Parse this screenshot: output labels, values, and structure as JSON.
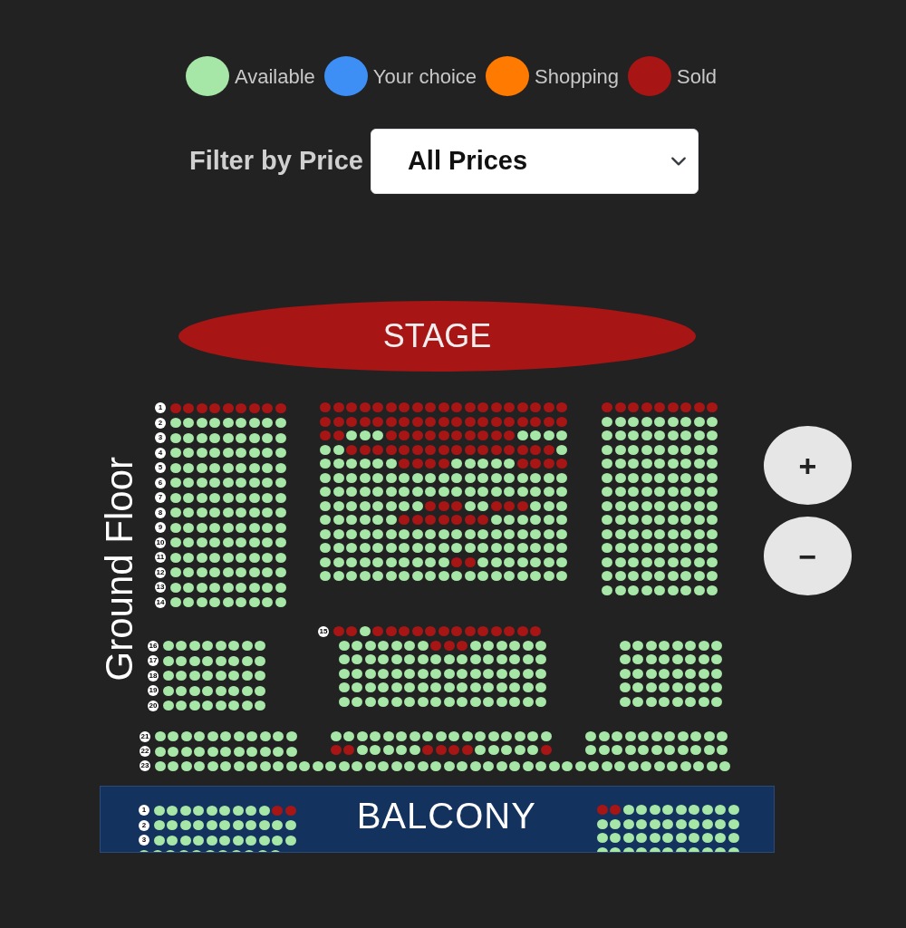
{
  "legend": [
    {
      "label": "Available",
      "color": "#a6e6a6"
    },
    {
      "label": "Your choice",
      "color": "#3d8ef5"
    },
    {
      "label": "Shopping",
      "color": "#ff7a00"
    },
    {
      "label": "Sold",
      "color": "#a81515"
    }
  ],
  "filter": {
    "label": "Filter by Price",
    "value": "All Prices"
  },
  "stage": "STAGE",
  "zoom_buttons": [
    "+",
    "−"
  ],
  "ground_floor": {
    "title": "Ground Floor",
    "tiers": [
      {
        "blocks": [
          {
            "rows": [
              {
                "label": "1",
                "sold": [
                  true,
                  true,
                  true,
                  true,
                  true,
                  true,
                  true,
                  true,
                  true
                ]
              },
              {
                "label": "2",
                "sold": [
                  false,
                  false,
                  false,
                  false,
                  false,
                  false,
                  false,
                  false,
                  false
                ]
              },
              {
                "label": "3",
                "sold": [
                  false,
                  false,
                  false,
                  false,
                  false,
                  false,
                  false,
                  false,
                  false
                ]
              },
              {
                "label": "4",
                "sold": [
                  false,
                  false,
                  false,
                  false,
                  false,
                  false,
                  false,
                  false,
                  false
                ]
              },
              {
                "label": "5",
                "sold": [
                  false,
                  false,
                  false,
                  false,
                  false,
                  false,
                  false,
                  false,
                  false
                ]
              },
              {
                "label": "6",
                "sold": [
                  false,
                  false,
                  false,
                  false,
                  false,
                  false,
                  false,
                  false,
                  false
                ]
              },
              {
                "label": "7",
                "sold": [
                  false,
                  false,
                  false,
                  false,
                  false,
                  false,
                  false,
                  false,
                  false
                ]
              },
              {
                "label": "8",
                "sold": [
                  false,
                  false,
                  false,
                  false,
                  false,
                  false,
                  false,
                  false,
                  false
                ]
              },
              {
                "label": "9",
                "sold": [
                  false,
                  false,
                  false,
                  false,
                  false,
                  false,
                  false,
                  false,
                  false
                ]
              },
              {
                "label": "10",
                "sold": [
                  false,
                  false,
                  false,
                  false,
                  false,
                  false,
                  false,
                  false,
                  false
                ]
              },
              {
                "label": "11",
                "sold": [
                  false,
                  false,
                  false,
                  false,
                  false,
                  false,
                  false,
                  false,
                  false
                ]
              },
              {
                "label": "12",
                "sold": [
                  false,
                  false,
                  false,
                  false,
                  false,
                  false,
                  false,
                  false,
                  false
                ]
              },
              {
                "label": "13",
                "sold": [
                  false,
                  false,
                  false,
                  false,
                  false,
                  false,
                  false,
                  false,
                  false
                ]
              },
              {
                "label": "14",
                "sold": [
                  false,
                  false,
                  false,
                  false,
                  false,
                  false,
                  false,
                  false,
                  false
                ]
              }
            ]
          },
          {
            "rows": [
              {
                "sold": [
                  true,
                  true,
                  true,
                  true,
                  true,
                  true,
                  true,
                  true,
                  true,
                  true,
                  true,
                  true,
                  true,
                  true,
                  true,
                  true,
                  true,
                  true,
                  true
                ]
              },
              {
                "sold": [
                  true,
                  true,
                  true,
                  true,
                  true,
                  true,
                  true,
                  true,
                  true,
                  true,
                  true,
                  true,
                  true,
                  true,
                  true,
                  true,
                  true,
                  true,
                  true
                ]
              },
              {
                "sold": [
                  true,
                  true,
                  false,
                  false,
                  false,
                  true,
                  true,
                  true,
                  true,
                  true,
                  true,
                  true,
                  true,
                  true,
                  true,
                  false,
                  false,
                  false,
                  false
                ]
              },
              {
                "sold": [
                  false,
                  false,
                  true,
                  true,
                  true,
                  true,
                  true,
                  true,
                  true,
                  true,
                  true,
                  true,
                  true,
                  true,
                  true,
                  true,
                  true,
                  true,
                  false
                ]
              },
              {
                "sold": [
                  false,
                  false,
                  false,
                  false,
                  false,
                  false,
                  true,
                  true,
                  true,
                  true,
                  false,
                  false,
                  false,
                  false,
                  false,
                  true,
                  true,
                  true,
                  true
                ]
              },
              {
                "sold": [
                  false,
                  false,
                  false,
                  false,
                  false,
                  false,
                  false,
                  false,
                  false,
                  false,
                  false,
                  false,
                  false,
                  false,
                  false,
                  false,
                  false,
                  false,
                  false
                ]
              },
              {
                "sold": [
                  false,
                  false,
                  false,
                  false,
                  false,
                  false,
                  false,
                  false,
                  false,
                  false,
                  false,
                  false,
                  false,
                  false,
                  false,
                  false,
                  false,
                  false,
                  false
                ]
              },
              {
                "sold": [
                  false,
                  false,
                  false,
                  false,
                  false,
                  false,
                  false,
                  false,
                  true,
                  true,
                  true,
                  false,
                  false,
                  true,
                  true,
                  true,
                  false,
                  false,
                  false
                ]
              },
              {
                "sold": [
                  false,
                  false,
                  false,
                  false,
                  false,
                  false,
                  true,
                  true,
                  true,
                  true,
                  true,
                  true,
                  true,
                  false,
                  false,
                  false,
                  false,
                  false,
                  false
                ]
              },
              {
                "sold": [
                  false,
                  false,
                  false,
                  false,
                  false,
                  false,
                  false,
                  false,
                  false,
                  false,
                  false,
                  false,
                  false,
                  false,
                  false,
                  false,
                  false,
                  false,
                  false
                ]
              },
              {
                "sold": [
                  false,
                  false,
                  false,
                  false,
                  false,
                  false,
                  false,
                  false,
                  false,
                  false,
                  false,
                  false,
                  false,
                  false,
                  false,
                  false,
                  false,
                  false,
                  false
                ]
              },
              {
                "sold": [
                  false,
                  false,
                  false,
                  false,
                  false,
                  false,
                  false,
                  false,
                  false,
                  false,
                  true,
                  true,
                  false,
                  false,
                  false,
                  false,
                  false,
                  false,
                  false
                ]
              },
              {
                "sold": [
                  false,
                  false,
                  false,
                  false,
                  false,
                  false,
                  false,
                  false,
                  false,
                  false,
                  false,
                  false,
                  false,
                  false,
                  false,
                  false,
                  false,
                  false,
                  false
                ]
              }
            ]
          },
          {
            "rows": [
              {
                "sold": [
                  true,
                  true,
                  true,
                  true,
                  true,
                  true,
                  true,
                  true,
                  true
                ]
              },
              {
                "sold": [
                  false,
                  false,
                  false,
                  false,
                  false,
                  false,
                  false,
                  false,
                  false
                ]
              },
              {
                "sold": [
                  false,
                  false,
                  false,
                  false,
                  false,
                  false,
                  false,
                  false,
                  false
                ]
              },
              {
                "sold": [
                  false,
                  false,
                  false,
                  false,
                  false,
                  false,
                  false,
                  false,
                  false
                ]
              },
              {
                "sold": [
                  false,
                  false,
                  false,
                  false,
                  false,
                  false,
                  false,
                  false,
                  false
                ]
              },
              {
                "sold": [
                  false,
                  false,
                  false,
                  false,
                  false,
                  false,
                  false,
                  false,
                  false
                ]
              },
              {
                "sold": [
                  false,
                  false,
                  false,
                  false,
                  false,
                  false,
                  false,
                  false,
                  false
                ]
              },
              {
                "sold": [
                  false,
                  false,
                  false,
                  false,
                  false,
                  false,
                  false,
                  false,
                  false
                ]
              },
              {
                "sold": [
                  false,
                  false,
                  false,
                  false,
                  false,
                  false,
                  false,
                  false,
                  false
                ]
              },
              {
                "sold": [
                  false,
                  false,
                  false,
                  false,
                  false,
                  false,
                  false,
                  false,
                  false
                ]
              },
              {
                "sold": [
                  false,
                  false,
                  false,
                  false,
                  false,
                  false,
                  false,
                  false,
                  false
                ]
              },
              {
                "sold": [
                  false,
                  false,
                  false,
                  false,
                  false,
                  false,
                  false,
                  false,
                  false
                ]
              },
              {
                "sold": [
                  false,
                  false,
                  false,
                  false,
                  false,
                  false,
                  false,
                  false,
                  false
                ]
              },
              {
                "sold": [
                  false,
                  false,
                  false,
                  false,
                  false,
                  false,
                  false,
                  false,
                  false
                ]
              }
            ]
          }
        ]
      },
      {
        "blocks": [
          {
            "rows": [
              {
                "label": "15",
                "sold": [
                  true,
                  true,
                  false,
                  true,
                  true,
                  true,
                  true,
                  true,
                  true,
                  true,
                  true,
                  true,
                  true,
                  true,
                  true,
                  true
                ]
              }
            ]
          }
        ]
      },
      {
        "blocks": [
          {
            "rows": [
              {
                "label": "16",
                "sold": [
                  false,
                  false,
                  false,
                  false,
                  false,
                  false,
                  false,
                  false
                ]
              },
              {
                "label": "17",
                "sold": [
                  false,
                  false,
                  false,
                  false,
                  false,
                  false,
                  false,
                  false
                ]
              },
              {
                "label": "18",
                "sold": [
                  false,
                  false,
                  false,
                  false,
                  false,
                  false,
                  false,
                  false
                ]
              },
              {
                "label": "19",
                "sold": [
                  false,
                  false,
                  false,
                  false,
                  false,
                  false,
                  false,
                  false
                ]
              },
              {
                "label": "20",
                "sold": [
                  false,
                  false,
                  false,
                  false,
                  false,
                  false,
                  false,
                  false
                ]
              }
            ]
          },
          {
            "rows": [
              {
                "sold": [
                  false,
                  false,
                  false,
                  false,
                  false,
                  false,
                  false,
                  true,
                  true,
                  true,
                  false,
                  false,
                  false,
                  false,
                  false,
                  false
                ]
              },
              {
                "sold": [
                  false,
                  false,
                  false,
                  false,
                  false,
                  false,
                  false,
                  false,
                  false,
                  false,
                  false,
                  false,
                  false,
                  false,
                  false,
                  false
                ]
              },
              {
                "sold": [
                  false,
                  false,
                  false,
                  false,
                  false,
                  false,
                  false,
                  false,
                  false,
                  false,
                  false,
                  false,
                  false,
                  false,
                  false,
                  false
                ]
              },
              {
                "sold": [
                  false,
                  false,
                  false,
                  false,
                  false,
                  false,
                  false,
                  false,
                  false,
                  false,
                  false,
                  false,
                  false,
                  false,
                  false,
                  false
                ]
              },
              {
                "sold": [
                  false,
                  false,
                  false,
                  false,
                  false,
                  false,
                  false,
                  false,
                  false,
                  false,
                  false,
                  false,
                  false,
                  false,
                  false,
                  false
                ]
              }
            ]
          },
          {
            "rows": [
              {
                "sold": [
                  false,
                  false,
                  false,
                  false,
                  false,
                  false,
                  false,
                  false
                ]
              },
              {
                "sold": [
                  false,
                  false,
                  false,
                  false,
                  false,
                  false,
                  false,
                  false
                ]
              },
              {
                "sold": [
                  false,
                  false,
                  false,
                  false,
                  false,
                  false,
                  false,
                  false
                ]
              },
              {
                "sold": [
                  false,
                  false,
                  false,
                  false,
                  false,
                  false,
                  false,
                  false
                ]
              },
              {
                "sold": [
                  false,
                  false,
                  false,
                  false,
                  false,
                  false,
                  false,
                  false
                ]
              }
            ]
          }
        ]
      },
      {
        "blocks": [
          {
            "rows": [
              {
                "label": "21",
                "sold": [
                  false,
                  false,
                  false,
                  false,
                  false,
                  false,
                  false,
                  false,
                  false,
                  false,
                  false
                ]
              },
              {
                "label": "22",
                "sold": [
                  false,
                  false,
                  false,
                  false,
                  false,
                  false,
                  false,
                  false,
                  false,
                  false,
                  false
                ]
              }
            ]
          },
          {
            "rows": [
              {
                "sold": [
                  false,
                  false,
                  false,
                  false,
                  false,
                  false,
                  false,
                  false,
                  false,
                  false,
                  false,
                  false,
                  false,
                  false,
                  false,
                  false,
                  false
                ]
              },
              {
                "sold": [
                  true,
                  true,
                  false,
                  false,
                  false,
                  false,
                  false,
                  true,
                  true,
                  true,
                  true,
                  false,
                  false,
                  false,
                  false,
                  false,
                  true
                ]
              }
            ]
          },
          {
            "rows": [
              {
                "sold": [
                  false,
                  false,
                  false,
                  false,
                  false,
                  false,
                  false,
                  false,
                  false,
                  false,
                  false
                ]
              },
              {
                "sold": [
                  false,
                  false,
                  false,
                  false,
                  false,
                  false,
                  false,
                  false,
                  false,
                  false,
                  false
                ]
              }
            ]
          }
        ]
      },
      {
        "blocks": [
          {
            "rows": [
              {
                "label": "23",
                "sold": [
                  false,
                  false,
                  false,
                  false,
                  false,
                  false,
                  false,
                  false,
                  false,
                  false,
                  false,
                  false,
                  false,
                  false,
                  false,
                  false,
                  false,
                  false,
                  false,
                  false,
                  false,
                  false,
                  false,
                  false,
                  false,
                  false,
                  false,
                  false,
                  false,
                  false,
                  false,
                  false,
                  false,
                  false,
                  false,
                  false,
                  false,
                  false,
                  false,
                  false,
                  false,
                  false,
                  false,
                  false
                ]
              }
            ]
          }
        ]
      }
    ]
  },
  "balcony": {
    "title": "BALCONY",
    "blocks": [
      {
        "rows": [
          {
            "label": "1",
            "sold": [
              false,
              false,
              false,
              false,
              false,
              false,
              false,
              false,
              false,
              true,
              true
            ]
          },
          {
            "label": "2",
            "sold": [
              false,
              false,
              false,
              false,
              false,
              false,
              false,
              false,
              false,
              false,
              false
            ]
          },
          {
            "label": "3",
            "sold": [
              false,
              false,
              false,
              false,
              false,
              false,
              false,
              false,
              false,
              false,
              false
            ]
          },
          {
            "sold": [
              false,
              false,
              false,
              false,
              false,
              false,
              false,
              false,
              false,
              false,
              false
            ]
          }
        ]
      },
      {
        "rows": [
          {
            "sold": [
              true,
              true,
              false,
              false,
              false,
              false,
              false,
              false,
              false,
              false,
              false
            ]
          },
          {
            "sold": [
              false,
              false,
              false,
              false,
              false,
              false,
              false,
              false,
              false,
              false,
              false
            ]
          },
          {
            "sold": [
              false,
              false,
              false,
              false,
              false,
              false,
              false,
              false,
              false,
              false,
              false
            ]
          },
          {
            "sold": [
              false,
              false,
              false,
              false,
              false,
              false,
              false,
              false,
              false,
              false,
              false
            ]
          }
        ]
      }
    ]
  }
}
